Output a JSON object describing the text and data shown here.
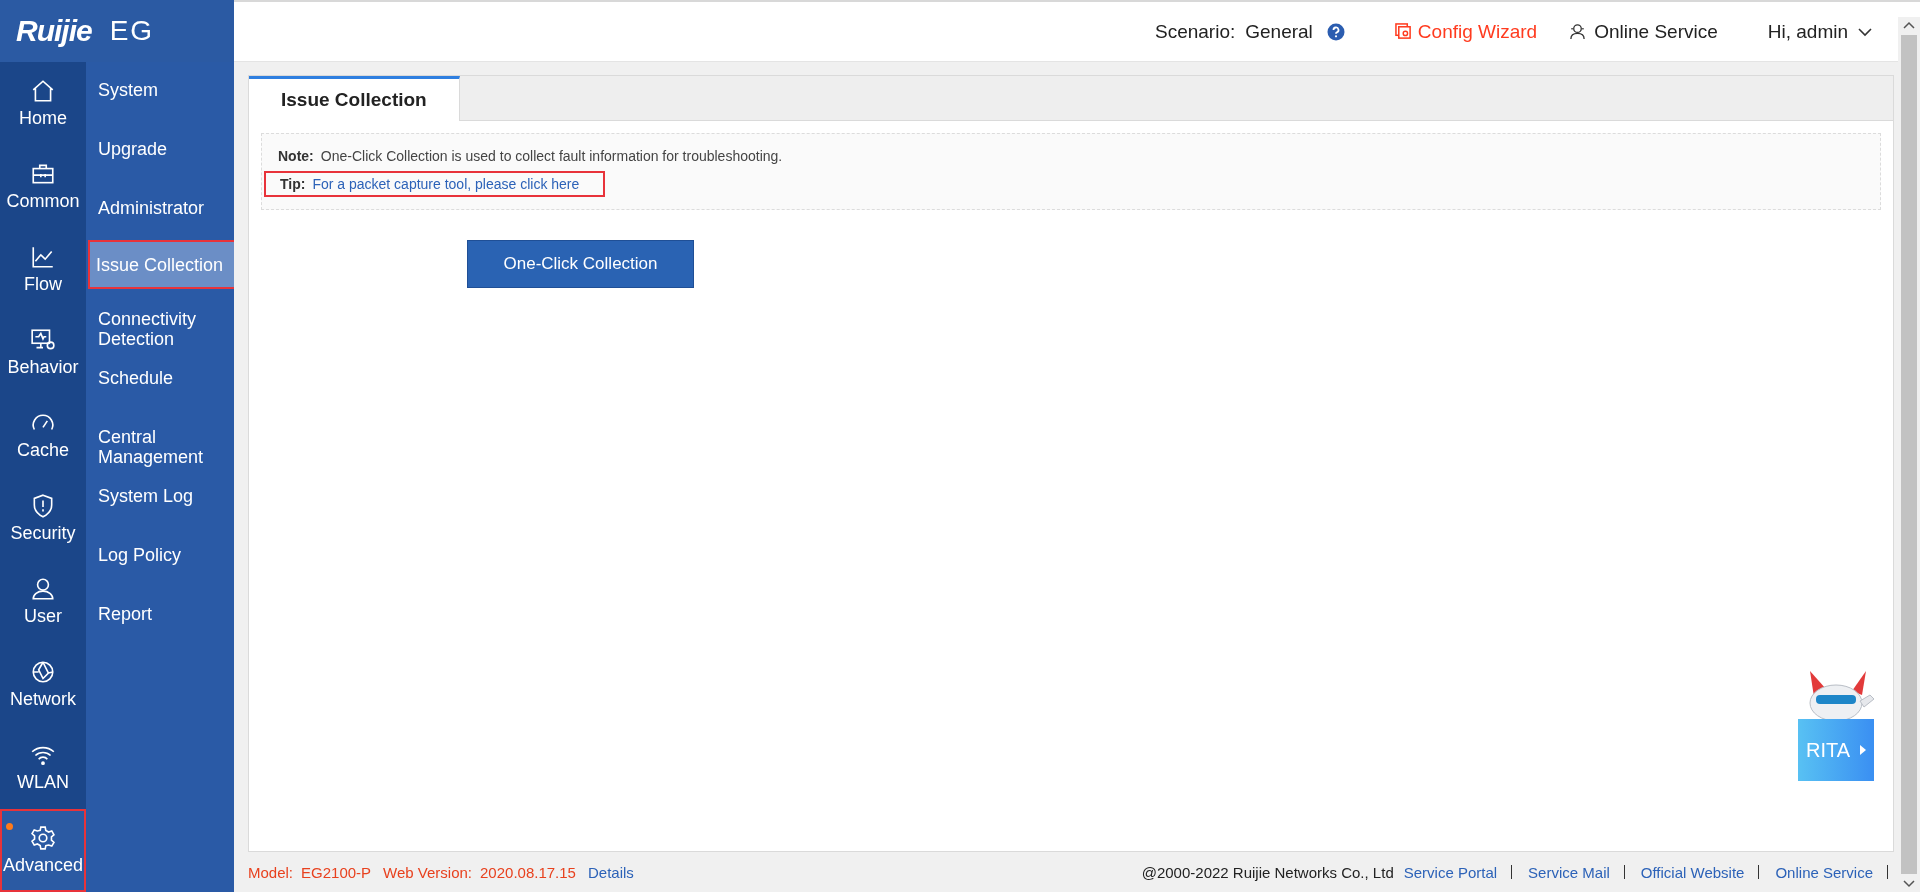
{
  "brand": {
    "logo": "Ruijie",
    "product": "EG"
  },
  "header": {
    "scenario_label": "Scenario:",
    "scenario_value": "General",
    "config_wizard": "Config Wizard",
    "online_service": "Online Service",
    "user": "Hi, admin"
  },
  "rail": [
    {
      "kind": "home",
      "label": "Home",
      "selected": false,
      "annotated": false
    },
    {
      "kind": "briefcase",
      "label": "Common",
      "selected": false,
      "annotated": false
    },
    {
      "kind": "chart",
      "label": "Flow",
      "selected": false,
      "annotated": false
    },
    {
      "kind": "monitor",
      "label": "Behavior",
      "selected": false,
      "annotated": false
    },
    {
      "kind": "gauge",
      "label": "Cache",
      "selected": false,
      "annotated": false
    },
    {
      "kind": "shield",
      "label": "Security",
      "selected": false,
      "annotated": false
    },
    {
      "kind": "user",
      "label": "User",
      "selected": false,
      "annotated": false
    },
    {
      "kind": "globe",
      "label": "Network",
      "selected": false,
      "annotated": false
    },
    {
      "kind": "wifi",
      "label": "WLAN",
      "selected": false,
      "annotated": false
    },
    {
      "kind": "gear",
      "label": "Advanced",
      "selected": true,
      "annotated": true
    }
  ],
  "submenu": [
    {
      "label": "System",
      "selected": false,
      "annotated": false
    },
    {
      "label": "Upgrade",
      "selected": false,
      "annotated": false
    },
    {
      "label": "Administrator",
      "selected": false,
      "annotated": false
    },
    {
      "label": "Issue Collection",
      "selected": true,
      "annotated": true
    },
    {
      "label": "Connectivity Detection",
      "selected": false,
      "annotated": false
    },
    {
      "label": "Schedule",
      "selected": false,
      "annotated": false
    },
    {
      "label": "Central Management",
      "selected": false,
      "annotated": false
    },
    {
      "label": "System Log",
      "selected": false,
      "annotated": false
    },
    {
      "label": "Log Policy",
      "selected": false,
      "annotated": false
    },
    {
      "label": "Report",
      "selected": false,
      "annotated": false
    }
  ],
  "tabs": [
    {
      "label": "Issue Collection",
      "selected": true
    }
  ],
  "note": {
    "label": "Note:",
    "text": "One-Click Collection is used to collect fault information for troubleshooting."
  },
  "tip": {
    "label": "Tip:",
    "link": "For a packet capture tool, please click here",
    "annotated": true
  },
  "collect_button": "One-Click Collection",
  "assistant": {
    "label": "RITA"
  },
  "footer": {
    "model_label": "Model:",
    "model": "EG2100-P",
    "version_label": "Web Version:",
    "version": "2020.08.17.15",
    "details": "Details",
    "copyright": "@2000-2022 Ruijie Networks Co., Ltd",
    "links": [
      "Service Portal",
      "Service Mail",
      "Official Website",
      "Online Service"
    ]
  }
}
